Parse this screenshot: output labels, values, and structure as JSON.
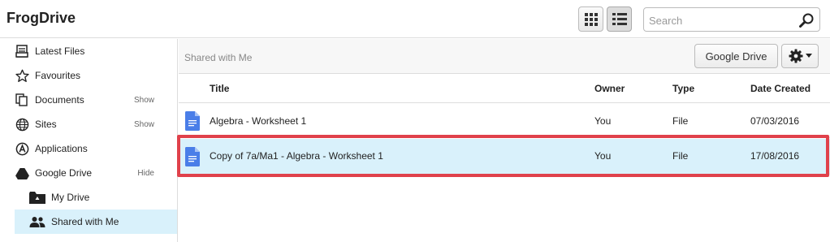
{
  "header": {
    "app_title": "FrogDrive",
    "search_placeholder": "Search"
  },
  "sidebar": {
    "items": [
      {
        "label": "Latest Files",
        "icon": "inbox-tray-icon"
      },
      {
        "label": "Favourites",
        "icon": "star-icon"
      },
      {
        "label": "Documents",
        "icon": "documents-icon",
        "action": "Show"
      },
      {
        "label": "Sites",
        "icon": "globe-icon",
        "action": "Show"
      },
      {
        "label": "Applications",
        "icon": "applications-icon"
      },
      {
        "label": "Google Drive",
        "icon": "google-drive-icon",
        "action": "Hide"
      },
      {
        "label": "My Drive",
        "icon": "drive-folder-icon"
      },
      {
        "label": "Shared with Me",
        "icon": "people-icon",
        "selected": true
      }
    ]
  },
  "main": {
    "breadcrumb": "Shared with Me",
    "google_drive_button": "Google Drive",
    "columns": [
      "Title",
      "Owner",
      "Type",
      "Date Created"
    ],
    "rows": [
      {
        "title": "Algebra - Worksheet 1",
        "owner": "You",
        "type": "File",
        "date": "07/03/2016"
      },
      {
        "title": "Copy of 7a/Ma1 - Algebra - Worksheet 1",
        "owner": "You",
        "type": "File",
        "date": "17/08/2016",
        "highlighted": true
      }
    ]
  },
  "colors": {
    "selection": "#d9f1fb",
    "outline": "#e0414b",
    "doc_icon": "#4a7ee8"
  }
}
